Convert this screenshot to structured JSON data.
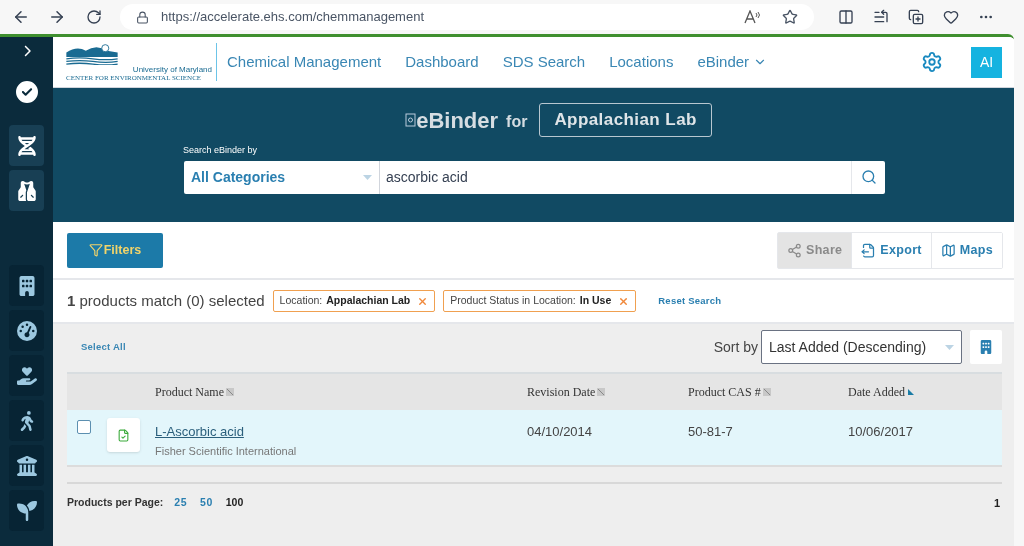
{
  "browser": {
    "url": "https://accelerate.ehs.com/chemmanagement"
  },
  "sidebar": {
    "groups": [
      [
        {
          "highlighted": true
        },
        {
          "highlighted": true
        }
      ],
      [
        {
          "highlighted": false
        },
        {
          "highlighted": false
        },
        {
          "highlighted": false
        },
        {
          "highlighted": false
        },
        {
          "highlighted": false
        },
        {
          "highlighted": false
        }
      ]
    ]
  },
  "logo": {
    "line_1": "University of Maryland",
    "line_2": "CENTER FOR ENVIRONMENTAL SCIENCE"
  },
  "nav": [
    {
      "label": "Chemical Management",
      "dropdown": false
    },
    {
      "label": "Dashboard",
      "dropdown": false
    },
    {
      "label": "SDS Search",
      "dropdown": false
    },
    {
      "label": "Locations",
      "dropdown": false
    },
    {
      "label": "eBinder",
      "dropdown": true
    }
  ],
  "user": {
    "initials": "AI"
  },
  "hero": {
    "title": "eBinder",
    "for": "for",
    "location": "Appalachian Lab",
    "search_label": "Search eBinder by",
    "category": "All Categories",
    "query": "ascorbic acid"
  },
  "toolbar": {
    "filters": "Filters",
    "actions": [
      {
        "label": "Share",
        "disabled": true
      },
      {
        "label": "Export",
        "disabled": false
      },
      {
        "label": "Maps",
        "disabled": false
      }
    ]
  },
  "summary": "**1** products match (0) selected",
  "chips": [
    {
      "label": "Location:",
      "value": "Appalachian Lab"
    },
    {
      "label": "Product Status in Location:",
      "value": "In Use"
    }
  ],
  "reset": "Reset Search",
  "select_all": "Select All",
  "sort": {
    "label": "Sort by",
    "value": "Last Added (Descending)"
  },
  "table": {
    "columns": [
      {
        "label": "Product Name",
        "sorted": false
      },
      {
        "label": "Revision Date",
        "sorted": false
      },
      {
        "label": "Product CAS #",
        "sorted": false
      },
      {
        "label": "Date Added",
        "sorted": true
      }
    ],
    "rows": [
      {
        "checked": false,
        "name": "L-Ascorbic acid",
        "manufacturer": "Fisher Scientific International",
        "revision_date": "04/10/2014",
        "cas": "50-81-7",
        "date_added": "10/06/2017"
      }
    ]
  },
  "pagination": {
    "label": "Products per Page:",
    "sizes": [
      {
        "label": "25",
        "selected": false
      },
      {
        "label": "50",
        "selected": false
      },
      {
        "label": "100",
        "selected": true
      }
    ],
    "page": "1"
  }
}
